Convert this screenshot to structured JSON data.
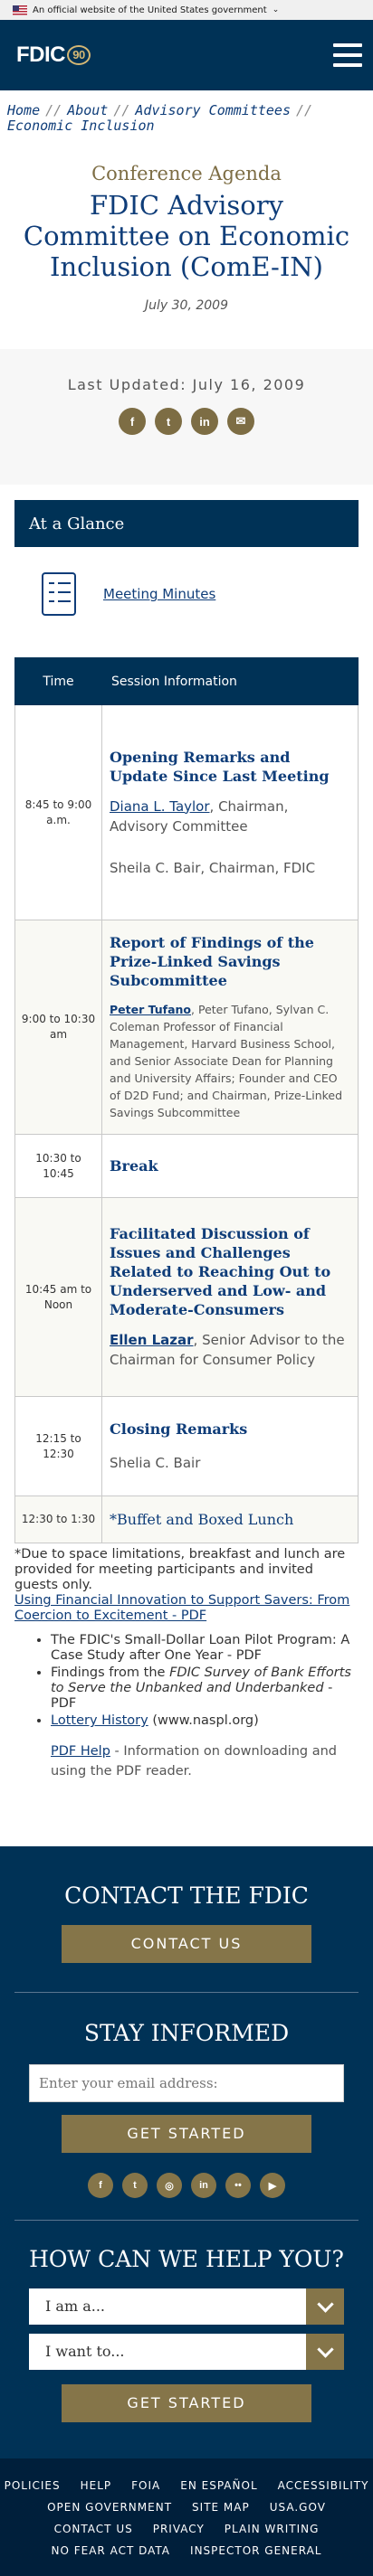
{
  "gov_banner": {
    "text": "An official website of the United States government"
  },
  "header": {
    "logo": "FDIC",
    "logo_mark": "90"
  },
  "breadcrumb": [
    "Home",
    "About",
    "Advisory Committees",
    "Economic Inclusion"
  ],
  "title_block": {
    "eyebrow": "Conference Agenda",
    "title": "FDIC Advisory Committee on Economic Inclusion (ComE-IN)",
    "date": "July 30, 2009"
  },
  "updated": {
    "text": "Last Updated: July 16, 2009",
    "share": [
      {
        "icon": "facebook-icon",
        "glyph": "f"
      },
      {
        "icon": "twitter-icon",
        "glyph": "t"
      },
      {
        "icon": "linkedin-icon",
        "glyph": "in"
      },
      {
        "icon": "email-icon",
        "glyph": "✉"
      }
    ]
  },
  "glance": {
    "heading": "At a Glance",
    "minutes_link": "Meeting Minutes"
  },
  "table": {
    "headers": {
      "time": "Time",
      "info": "Session Information"
    },
    "rows": [
      {
        "time": "8:45 to 9:00 a.m.",
        "title": "Opening Remarks and Update Since Last Meeting",
        "speaker": "Diana L. Taylor",
        "speaker_rest": ", Chairman, Advisory Committee",
        "extra": "Sheila C. Bair, Chairman, FDIC"
      },
      {
        "time": "9:00 to 10:30 am",
        "title": "Report of Findings of the Prize-Linked Savings Subcommittee",
        "speaker": "Peter Tufano",
        "speaker_rest": ", Peter Tufano, Sylvan C. Coleman Professor of Financial Management, Harvard Business School, and Senior Associate Dean for Planning and University Affairs; Founder and CEO of D2D Fund; and Chairman, Prize-Linked Savings Subcommittee"
      },
      {
        "time": "10:30 to 10:45",
        "title": "Break"
      },
      {
        "time": "10:45 am to Noon",
        "title": "Facilitated Discussion of Issues and Challenges Related to Reaching Out to Underserved and Low- and Moderate-Consumers",
        "speaker": "Ellen Lazar",
        "speaker_rest": ", Senior Advisor to the Chairman for Consumer Policy"
      },
      {
        "time": "12:15 to 12:30",
        "title": "Closing Remarks",
        "extra": "Shelia C. Bair"
      },
      {
        "time": "12:30 to 1:30",
        "title": "*Buffet and Boxed Lunch"
      }
    ]
  },
  "notes": {
    "footnote": "*Due to space limitations, breakfast and lunch are provided for meeting participants and invited guests only.",
    "link": "Using Financial Innovation to Support Savers: From Coercion to Excitement - PDF",
    "bullets": {
      "b1": "The FDIC's Small-Dollar Loan Pilot Program: A Case Study after One Year - PDF",
      "b2_pre": "Findings from the ",
      "b2_em": "FDIC Survey of Bank Efforts to Serve the Unbanked and Underbanked",
      "b2_post": " - PDF",
      "b3_link": "Lottery History",
      "b3_rest": " (www.naspl.org)"
    },
    "pdf_help_link": "PDF Help",
    "pdf_help_rest": " - Information on downloading and using the PDF reader."
  },
  "footer": {
    "contact_heading": "CONTACT THE FDIC",
    "contact_button": "CONTACT US",
    "stay_heading": "STAY INFORMED",
    "email_placeholder": "Enter your email address:",
    "get_started": "GET STARTED",
    "social": [
      "f",
      "t",
      "◎",
      "in",
      "••",
      "▶"
    ],
    "help_heading": "HOW CAN WE HELP YOU?",
    "select1": "I am a...",
    "select2": "I want to...",
    "get_started2": "GET STARTED",
    "nav": {
      "row1": [
        "POLICIES",
        "HELP",
        "FOIA",
        "EN ESPAÑOL",
        "ACCESSIBILITY"
      ],
      "row2": [
        "OPEN GOVERNMENT",
        "SITE MAP",
        "USA.GOV"
      ],
      "row3": [
        "CONTACT US",
        "PRIVACY",
        "PLAIN WRITING"
      ],
      "row4": [
        "NO FEAR ACT DATA",
        "INSPECTOR GENERAL"
      ]
    }
  }
}
